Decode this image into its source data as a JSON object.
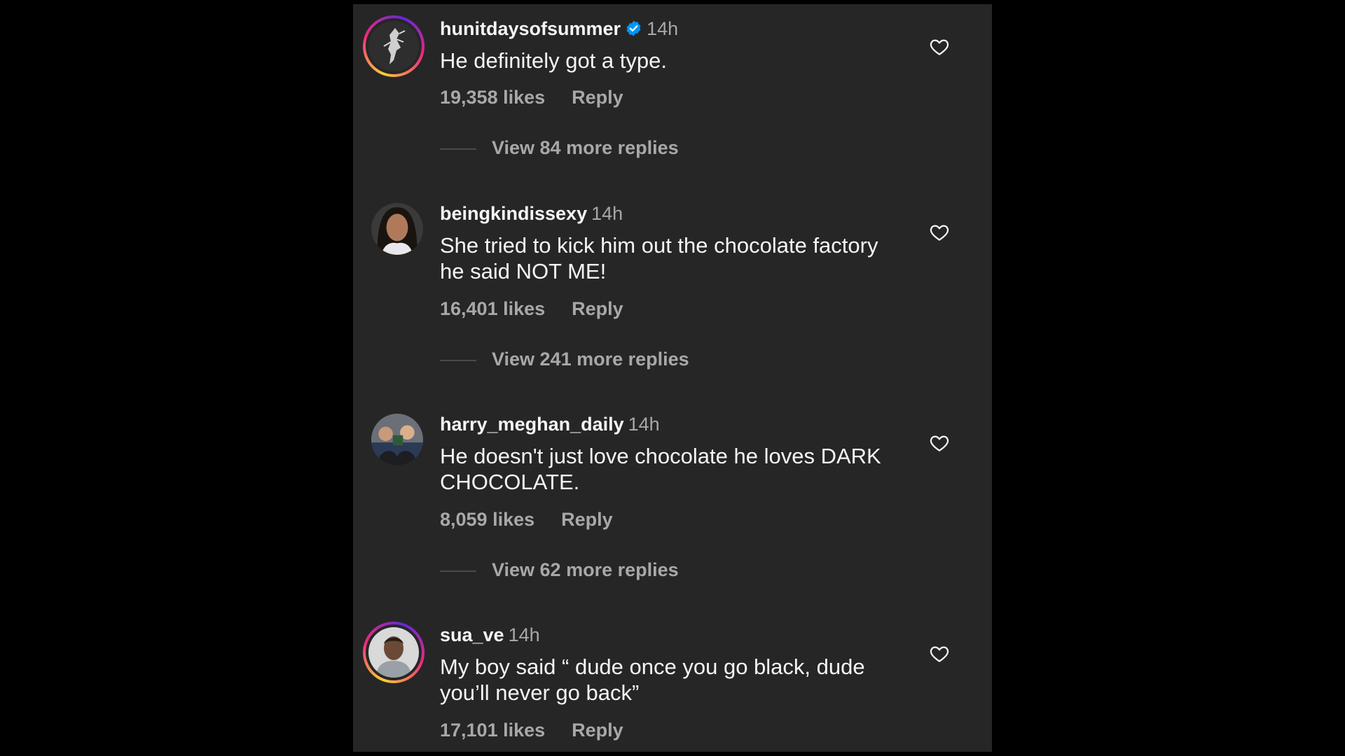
{
  "comments": [
    {
      "username": "hunitdaysofsummer",
      "verified": true,
      "time": "14h",
      "text": "He definitely got a type.",
      "likes": "19,358 likes",
      "reply_label": "Reply",
      "more_replies": "View 84 more replies",
      "avatar_ring": true
    },
    {
      "username": "beingkindissexy",
      "verified": false,
      "time": "14h",
      "text": "She tried to kick him out the chocolate factory he said NOT ME!",
      "likes": "16,401 likes",
      "reply_label": "Reply",
      "more_replies": "View 241 more replies",
      "avatar_ring": false
    },
    {
      "username": "harry_meghan_daily",
      "verified": false,
      "time": "14h",
      "text": "He doesn't just love chocolate he loves DARK CHOCOLATE.",
      "likes": "8,059 likes",
      "reply_label": "Reply",
      "more_replies": "View 62 more replies",
      "avatar_ring": false
    },
    {
      "username": "sua_ve",
      "verified": false,
      "time": "14h",
      "text": "My boy said “ dude once you go black, dude you’ll never go back”",
      "likes": "17,101 likes",
      "reply_label": "Reply",
      "avatar_ring": true
    }
  ],
  "colors": {
    "background": "#000000",
    "panel": "#262626",
    "primary_text": "#f5f5f5",
    "secondary_text": "#a8a8a8",
    "verified_badge": "#0095f6"
  }
}
